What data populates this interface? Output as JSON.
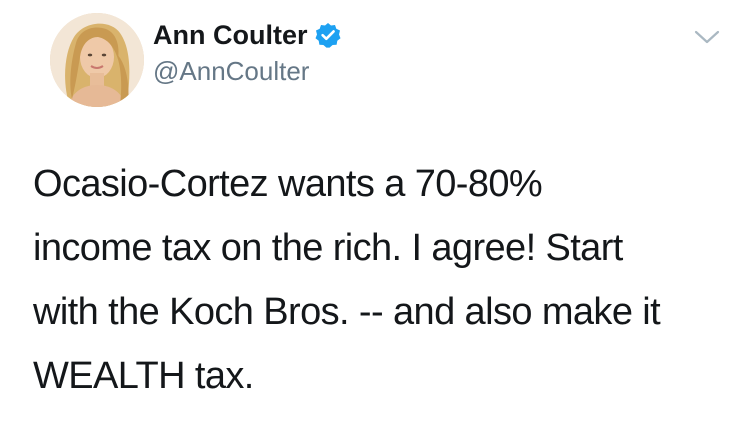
{
  "author": {
    "display_name": "Ann Coulter",
    "handle": "@AnnCoulter",
    "verified_icon": "verified-badge-icon",
    "avatar_icon": "profile-photo"
  },
  "menu": {
    "icon": "chevron-down-icon"
  },
  "tweet": {
    "lines": [
      "Ocasio-Cortez wants a 70-80%",
      "income tax on the rich. I agree! Start",
      "with the Koch Bros. -- and also make it",
      "WEALTH tax."
    ]
  },
  "colors": {
    "verified_blue": "#1da1f2",
    "handle_gray": "#657786",
    "text_dark": "#14171a",
    "chevron_gray": "#aab8c2"
  }
}
